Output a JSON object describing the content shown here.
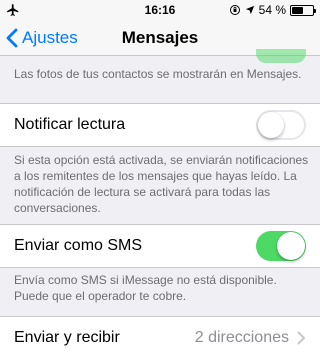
{
  "status_bar": {
    "time": "16:16",
    "battery_text": "54 %",
    "battery_level": 0.54
  },
  "nav": {
    "back_label": "Ajustes",
    "title": "Mensajes"
  },
  "sections": {
    "contact_photos_footer": "Las fotos de tus contactos se mostrarán en Mensajes.",
    "read_receipts": {
      "label": "Notificar lectura",
      "enabled": false,
      "footer": "Si esta opción está activada, se enviarán notificaciones a los remitentes de los mensajes que hayas leído. La notificación de lectura se activará para todas las conversaciones."
    },
    "send_as_sms": {
      "label": "Enviar como SMS",
      "enabled": true,
      "footer": "Envía como SMS si iMessage no está disponible. Puede que el operador te cobre."
    },
    "send_receive": {
      "label": "Enviar y recibir",
      "detail": "2 direcciones"
    }
  },
  "colors": {
    "accent": "#007aff",
    "switch_on": "#4cd964",
    "background": "#efeff4"
  }
}
